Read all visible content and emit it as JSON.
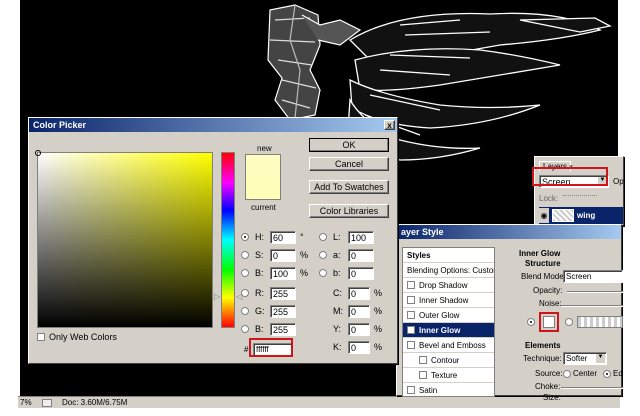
{
  "status": {
    "zoom": "7%",
    "doc": "Doc: 3.60M/6.75M"
  },
  "color_picker": {
    "title": "Color Picker",
    "new_label": "new",
    "current_label": "current",
    "ok": "OK",
    "cancel": "Cancel",
    "add_to_swatches": "Add To Swatches",
    "color_libraries": "Color Libraries",
    "only_web_colors": "Only Web Colors",
    "close": "x",
    "new_color": "#fffec0",
    "current_color": "#fffeb8",
    "hsb": [
      {
        "label": "H:",
        "value": "60",
        "unit": "°"
      },
      {
        "label": "S:",
        "value": "0",
        "unit": "%"
      },
      {
        "label": "B:",
        "value": "100",
        "unit": "%"
      }
    ],
    "rgb": [
      {
        "label": "R:",
        "value": "255"
      },
      {
        "label": "G:",
        "value": "255"
      },
      {
        "label": "B:",
        "value": "255"
      }
    ],
    "lab": [
      {
        "label": "L:",
        "value": "100"
      },
      {
        "label": "a:",
        "value": "0"
      },
      {
        "label": "b:",
        "value": "0"
      }
    ],
    "cmyk": [
      {
        "label": "C:",
        "value": "0",
        "unit": "%"
      },
      {
        "label": "M:",
        "value": "0",
        "unit": "%"
      },
      {
        "label": "Y:",
        "value": "0",
        "unit": "%"
      },
      {
        "label": "K:",
        "value": "0",
        "unit": "%"
      }
    ],
    "hex_prefix": "#",
    "hex": "ffffff"
  },
  "layers": {
    "tab": "Layers",
    "blend_mode": "Screen",
    "opacity_short": "Op",
    "lock": "Lock:",
    "layer_name": "wing"
  },
  "layer_style": {
    "title": "ayer Style",
    "styles_header": "Styles",
    "blending_options": "Blending Options: Custom",
    "items": [
      {
        "label": "Drop Shadow",
        "checked": false,
        "indent": false,
        "selected": false
      },
      {
        "label": "Inner Shadow",
        "checked": false,
        "indent": false,
        "selected": false
      },
      {
        "label": "Outer Glow",
        "checked": false,
        "indent": false,
        "selected": false
      },
      {
        "label": "Inner Glow",
        "checked": true,
        "indent": false,
        "selected": true
      },
      {
        "label": "Bevel and Emboss",
        "checked": false,
        "indent": false,
        "selected": false
      },
      {
        "label": "Contour",
        "checked": false,
        "indent": true,
        "selected": false
      },
      {
        "label": "Texture",
        "checked": false,
        "indent": true,
        "selected": false
      },
      {
        "label": "Satin",
        "checked": false,
        "indent": false,
        "selected": false
      }
    ],
    "inner_glow_title": "Inner Glow",
    "structure_title": "Structure",
    "blend_mode_label": "Blend Mode:",
    "blend_mode_value": "Screen",
    "opacity_label": "Opacity:",
    "noise_label": "Noise:",
    "elements_title": "Elements",
    "technique_label": "Technique:",
    "technique_value": "Softer",
    "source_label": "Source:",
    "source_center": "Center",
    "source_edge": "Ed",
    "choke_label": "Choke:",
    "size_label": "Size:"
  }
}
